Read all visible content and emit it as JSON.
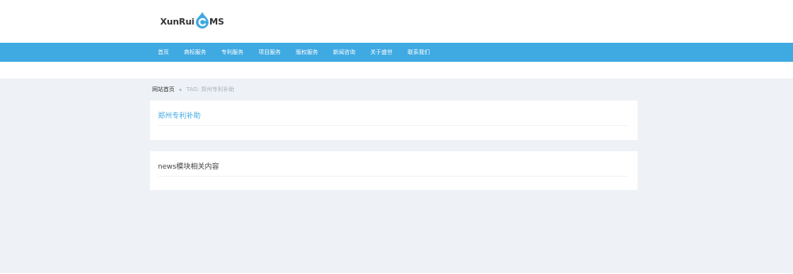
{
  "logo": {
    "part1": "XunRui",
    "part2": "MS"
  },
  "nav": {
    "items": [
      "首页",
      "商标服务",
      "专利服务",
      "项目服务",
      "版权服务",
      "新闻咨询",
      "关于盛世",
      "联系我们"
    ]
  },
  "breadcrumb": {
    "home": "网站首页",
    "current": "TAG: 郑州专利补助"
  },
  "tag_panel": {
    "title": "郑州专利补助"
  },
  "related_panel": {
    "title": "news模块相关内容"
  },
  "colors": {
    "nav_bg": "#3fa9e2",
    "page_bg": "#eef1f5",
    "accent": "#3fa9e2"
  }
}
